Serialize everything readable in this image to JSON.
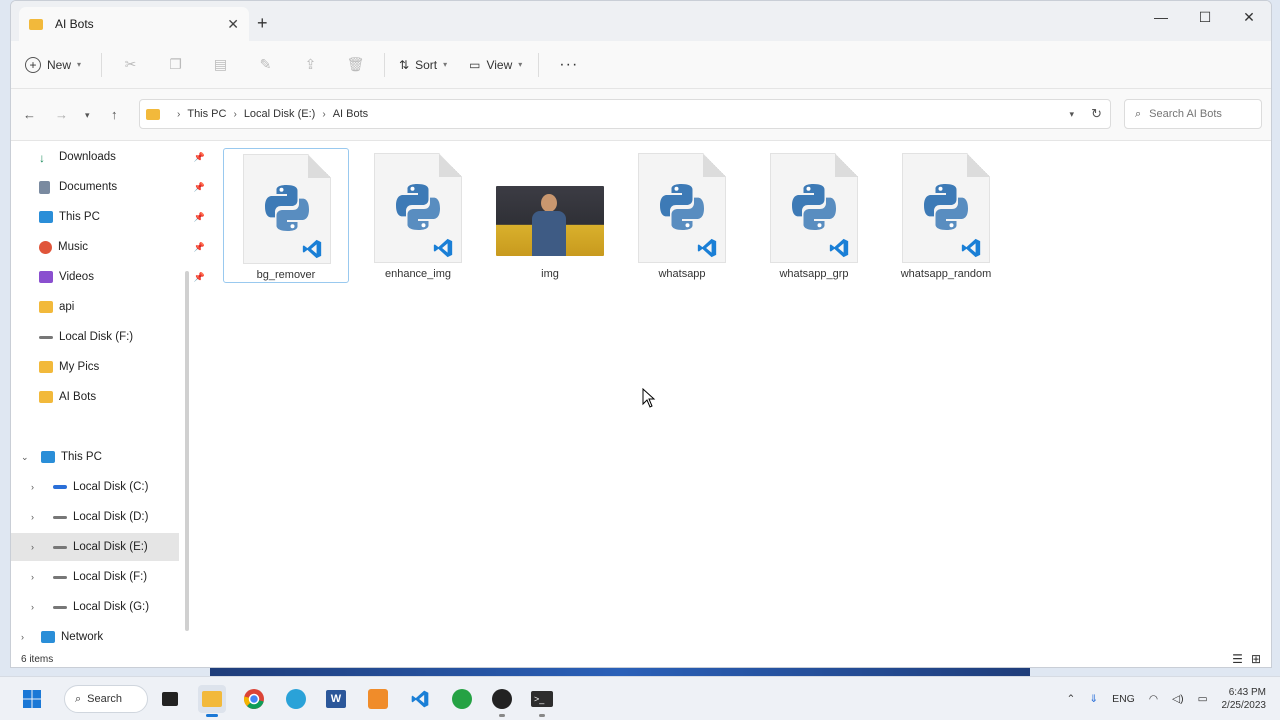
{
  "window": {
    "tab_title": "AI Bots",
    "tab_close": "✕",
    "new_tab": "+",
    "controls": {
      "minimize": "—",
      "maximize": "☐",
      "close": "✕"
    }
  },
  "command_bar": {
    "new_label": "New",
    "sort_label": "Sort",
    "view_label": "View",
    "more": "···"
  },
  "address": {
    "crumbs": [
      "This PC",
      "Local Disk (E:)",
      "AI Bots"
    ],
    "search_placeholder": "Search AI Bots"
  },
  "sidebar": {
    "quick_access": [
      {
        "label": "Downloads",
        "pinned": true
      },
      {
        "label": "Documents",
        "pinned": true
      },
      {
        "label": "This PC",
        "pinned": true
      },
      {
        "label": "Music",
        "pinned": true
      },
      {
        "label": "Videos",
        "pinned": true
      },
      {
        "label": "api",
        "pinned": false
      },
      {
        "label": "Local Disk (F:)",
        "pinned": false
      },
      {
        "label": "My Pics",
        "pinned": false
      },
      {
        "label": "AI Bots",
        "pinned": false
      }
    ],
    "this_pc": "This PC",
    "drives": [
      "Local Disk (C:)",
      "Local Disk (D:)",
      "Local Disk (E:)",
      "Local Disk (F:)",
      "Local Disk (G:)"
    ],
    "network": "Network"
  },
  "files": [
    {
      "name": "bg_remover",
      "type": "python",
      "selected": true
    },
    {
      "name": "enhance_img",
      "type": "python",
      "selected": false
    },
    {
      "name": "img",
      "type": "image",
      "selected": false
    },
    {
      "name": "whatsapp",
      "type": "python",
      "selected": false
    },
    {
      "name": "whatsapp_grp",
      "type": "python",
      "selected": false
    },
    {
      "name": "whatsapp_random",
      "type": "python",
      "selected": false
    }
  ],
  "status": {
    "item_count": "6 items"
  },
  "taskbar": {
    "search_label": "Search",
    "language": "ENG",
    "time": "6:43 PM",
    "date": "2/25/2023"
  }
}
